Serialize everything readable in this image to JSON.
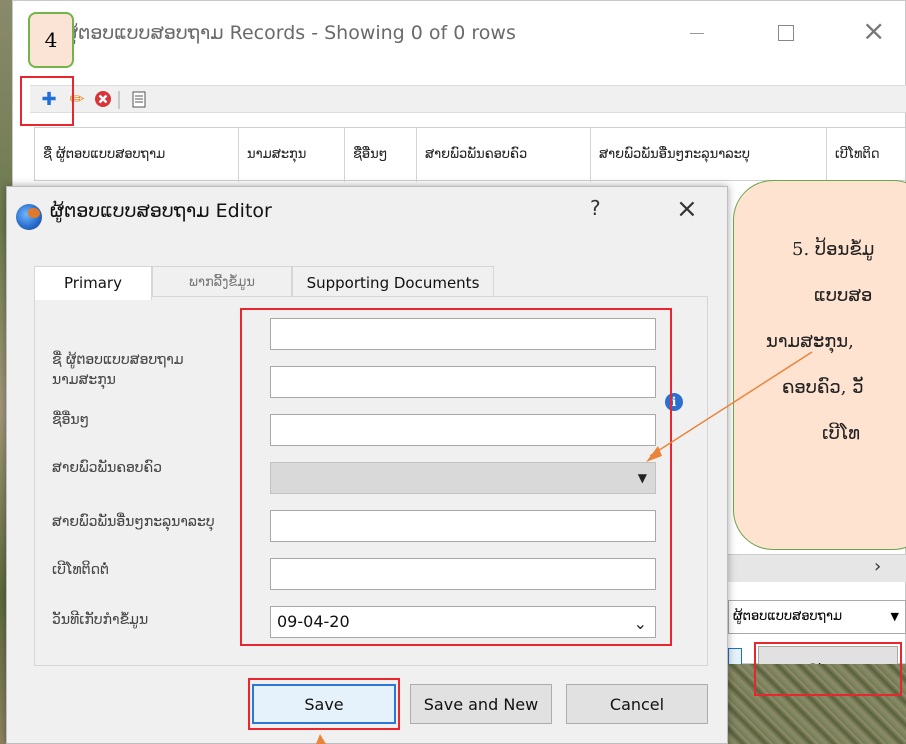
{
  "badge": {
    "number": "4"
  },
  "records_window": {
    "title": "ຜູ້ຕອບແບບສອບຖາມ Records - Showing 0 of 0 rows",
    "columns": [
      "ຊື່ ຜູ້ຕອບແບບສອບຖາມ",
      "ນາມສະກຸນ",
      "ຊື່ອື່ນໆ",
      "ສາຍພົວພັນຄອບຄົວ",
      "ສາຍພົວພັນອື່ນໆກະລຸນາລະບຸ",
      "ເບີໂທຕິດ"
    ],
    "combo_value": "ຜູ້ຕອບແບບສອບຖາມ",
    "close_label": "Close"
  },
  "editor": {
    "title": "ຜູ້ຕອບແບບສອບຖາມ Editor",
    "help": "?",
    "close": "×",
    "tabs": [
      "Primary",
      "ພາກລີ້ງຂໍ້ມູນ",
      "Supporting Documents"
    ],
    "fields": [
      {
        "label": "ຊື່ ຜູ້ຕອບແບບສອບຖາມ",
        "value": ""
      },
      {
        "label": "ນາມສະກຸນ",
        "value": ""
      },
      {
        "label": "ຊື່ອື່ນໆ",
        "value": ""
      },
      {
        "label": "ສາຍພົວພັນຄອບຄົວ",
        "value": ""
      },
      {
        "label": "ສາຍພົວພັນອື່ນໆກະລຸນາລະບຸ",
        "value": ""
      },
      {
        "label": "ເບີໂທຕິດຕໍ່",
        "value": ""
      },
      {
        "label": "ວັນທີເກັບກຳຂໍ້ມູນ",
        "value": "09-04-20"
      }
    ],
    "buttons": {
      "save": "Save",
      "save_and_new": "Save and New",
      "cancel": "Cancel"
    }
  },
  "callout": {
    "lines": [
      "5. ປ້ອນຂໍ້ມູ",
      "ແບບສອ",
      "ນາມສະກຸນ,",
      "ຄອບຄົວ, ວັ",
      "ເບີໂທ"
    ]
  },
  "colors": {
    "annotation_red": "#e8262d",
    "callout_fill": "#fde3d0",
    "callout_border": "#6aa64a",
    "accent_blue": "#2b79d4"
  }
}
